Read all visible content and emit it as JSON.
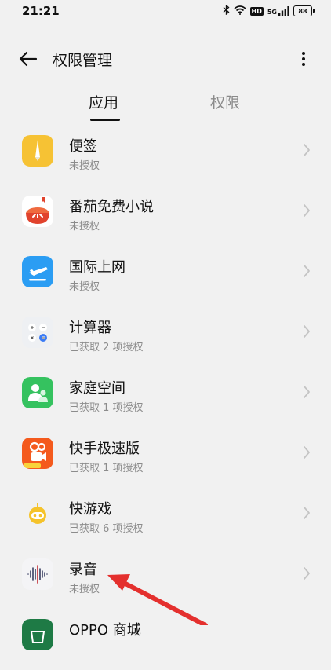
{
  "status_bar": {
    "time": "21:21",
    "hd": "HD",
    "network": "5G",
    "battery": "88",
    "icons": [
      "bluetooth-icon",
      "wifi-icon",
      "hd-icon",
      "signal-icon",
      "battery-icon"
    ]
  },
  "header": {
    "title": "权限管理",
    "back_icon": "back-arrow-icon",
    "more_icon": "more-vertical-icon"
  },
  "tabs": [
    {
      "label": "应用",
      "selected": true
    },
    {
      "label": "权限",
      "selected": false
    }
  ],
  "apps": [
    {
      "name": "便签",
      "status": "未授权",
      "icon": "notes-icon",
      "color": "#f6c234"
    },
    {
      "name": "番茄免费小说",
      "status": "未授权",
      "icon": "tomato-novel-icon",
      "color": "#e1432d"
    },
    {
      "name": "国际上网",
      "status": "未授权",
      "icon": "airplane-icon",
      "color": "#2b9df3"
    },
    {
      "name": "计算器",
      "status": "已获取 2 项授权",
      "icon": "calculator-icon",
      "color": "#eef0f3"
    },
    {
      "name": "家庭空间",
      "status": "已获取 1 项授权",
      "icon": "family-space-icon",
      "color": "#35c25f"
    },
    {
      "name": "快手极速版",
      "status": "已获取 1 项授权",
      "icon": "kuaishou-icon",
      "color": "#f45a1d"
    },
    {
      "name": "快游戏",
      "status": "已获取 6 项授权",
      "icon": "quick-game-icon",
      "color": "#f5c32b"
    },
    {
      "name": "录音",
      "status": "未授权",
      "icon": "recorder-icon",
      "color": "#f4f4f6"
    },
    {
      "name": "OPPO 商城",
      "status": "",
      "icon": "oppo-store-icon",
      "color": "#1e7a45"
    }
  ],
  "annotation": {
    "arrow_color": "#e4302e"
  }
}
